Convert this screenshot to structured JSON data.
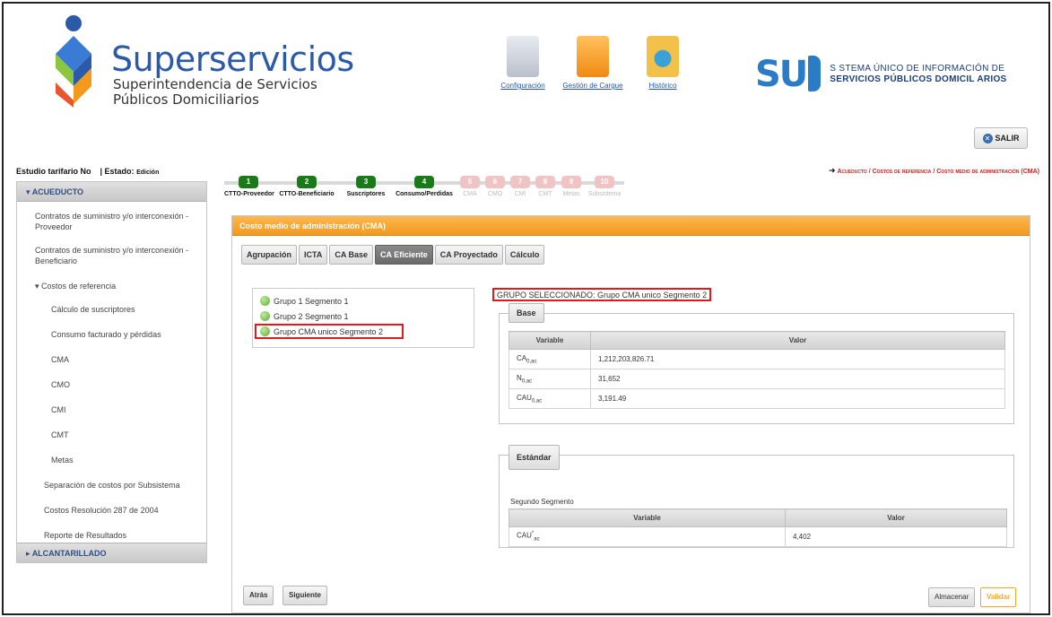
{
  "header": {
    "brand_title": "Superservicios",
    "brand_sub1": "Superintendencia de Servicios",
    "brand_sub2": "Públicos Domiciliarios",
    "nav": [
      {
        "label": "Configuración",
        "icon": "calendar-icon",
        "color": "#c9d0da"
      },
      {
        "label": "Gestión de Cargue",
        "icon": "folder-icon",
        "color": "#f39a1d"
      },
      {
        "label": "Histórico",
        "icon": "clock-icon",
        "color": "#f0b02a"
      }
    ],
    "sui_mark": "SU",
    "sui_line1": "S STEMA ÚNICO DE INFORMACIÓN DE",
    "sui_line2": "SERVICIOS PÚBLICOS DOMICIL ARIOS",
    "logout": "SALIR"
  },
  "status": {
    "study": "Estudio tarifario No",
    "state_label": "| Estado:",
    "state_value": "Edición"
  },
  "breadcrumb": "Acueducto / Costos de referencia / Costo medio de administración (CMA)",
  "sidebar": {
    "section_1": "ACUEDUCTO",
    "items": [
      "Contratos de suministro y/o interconexión - Proveedor",
      "Contratos de suministro y/o interconexión - Beneficiario",
      "Costos de referencia"
    ],
    "sub_items": [
      "Cálculo de suscriptores",
      "Consumo facturado y pérdidas",
      "CMA",
      "CMO",
      "CMI",
      "CMT",
      "Metas"
    ],
    "items_after": [
      "Separación de costos por Subsistema",
      "Costos Resolución 287 de 2004",
      "Reporte de Resultados"
    ],
    "section_2": "ALCANTARILLADO"
  },
  "steps": [
    {
      "num": "1",
      "label": "CTTO-Proveedor",
      "done": true
    },
    {
      "num": "2",
      "label": "CTTO-Beneficiario",
      "done": true
    },
    {
      "num": "3",
      "label": "Suscriptores",
      "done": true
    },
    {
      "num": "4",
      "label": "Consumo/Perdidas",
      "done": true
    },
    {
      "num": "5",
      "label": "CMA",
      "done": false
    },
    {
      "num": "6",
      "label": "CMO",
      "done": false
    },
    {
      "num": "7",
      "label": "CMI",
      "done": false
    },
    {
      "num": "8",
      "label": "CMT",
      "done": false
    },
    {
      "num": "9",
      "label": "Metas",
      "done": false
    },
    {
      "num": "10",
      "label": "Subsistema",
      "done": false
    }
  ],
  "panel": {
    "title": "Costo medio de administración (CMA)",
    "tabs": [
      "Agrupación",
      "ICTA",
      "CA Base",
      "CA Eficiente",
      "CA Proyectado",
      "Cálculo"
    ],
    "active_tab": "CA Eficiente",
    "groups": [
      "Grupo 1 Segmento 1",
      "Grupo 2 Segmento 1",
      "Grupo CMA unico Segmento 2"
    ],
    "selected_label": "GRUPO SELECCIONADO: Grupo CMA unico Segmento 2",
    "base": {
      "legend": "Base",
      "col_variable": "Variable",
      "col_valor": "Valor",
      "rows": [
        {
          "var": "CA",
          "sub": "0,ac",
          "val": "1,212,203,826.71"
        },
        {
          "var": "N",
          "sub": "0,ac",
          "val": "31,652"
        },
        {
          "var": "CAU",
          "sub": "0,ac",
          "val": "3,191.49"
        }
      ]
    },
    "estandar": {
      "legend": "Estándar",
      "segment": "Segundo Segmento",
      "col_variable": "Variable",
      "col_valor": "Valor",
      "row_var": "CAU",
      "row_sup": "*",
      "row_sub": "ac",
      "row_val": "4,402"
    },
    "btn_back": "Atrás",
    "btn_next": "Siguiente",
    "btn_save": "Almacenar",
    "btn_validate": "Validar"
  }
}
